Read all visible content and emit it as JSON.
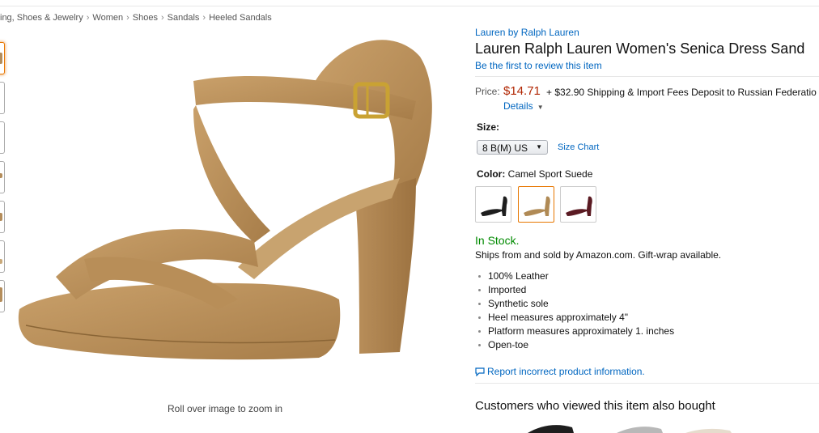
{
  "breadcrumb": [
    "ing, Shoes & Jewelry",
    "Women",
    "Shoes",
    "Sandals",
    "Heeled Sandals"
  ],
  "breadcrumb_separator": "›",
  "image": {
    "zoom_hint": "Roll over image to zoom in"
  },
  "product": {
    "brand": "Lauren by Ralph Lauren",
    "title": "Lauren Ralph Lauren Women's Senica Dress Sand",
    "review_link": "Be the first to review this item"
  },
  "price": {
    "label": "Price:",
    "value": "$14.71",
    "shipping": "+ $32.90 Shipping & Import Fees Deposit to Russian Federatio",
    "details": "Details"
  },
  "size": {
    "label": "Size:",
    "selected": "8 B(M) US",
    "chart_link": "Size Chart"
  },
  "color": {
    "label": "Color:",
    "value": "Camel Sport Suede",
    "swatch_colors": [
      "#1e1e1e",
      "#b08a55",
      "#5a1a22"
    ]
  },
  "availability": {
    "status": "In Stock.",
    "ships": "Ships from and sold by Amazon.com. Gift-wrap available."
  },
  "features": [
    "100% Leather",
    "Imported",
    "Synthetic sole",
    "Heel measures approximately 4\"",
    "Platform measures approximately 1. inches",
    "Open-toe"
  ],
  "report_link": "Report incorrect product information.",
  "also_bought": {
    "heading": "Customers who viewed this item also bought"
  },
  "colors": {
    "link": "#0066c0",
    "price": "#b12704",
    "in_stock": "#008a00",
    "selected_border": "#e77600",
    "suede": "#c49a63"
  }
}
